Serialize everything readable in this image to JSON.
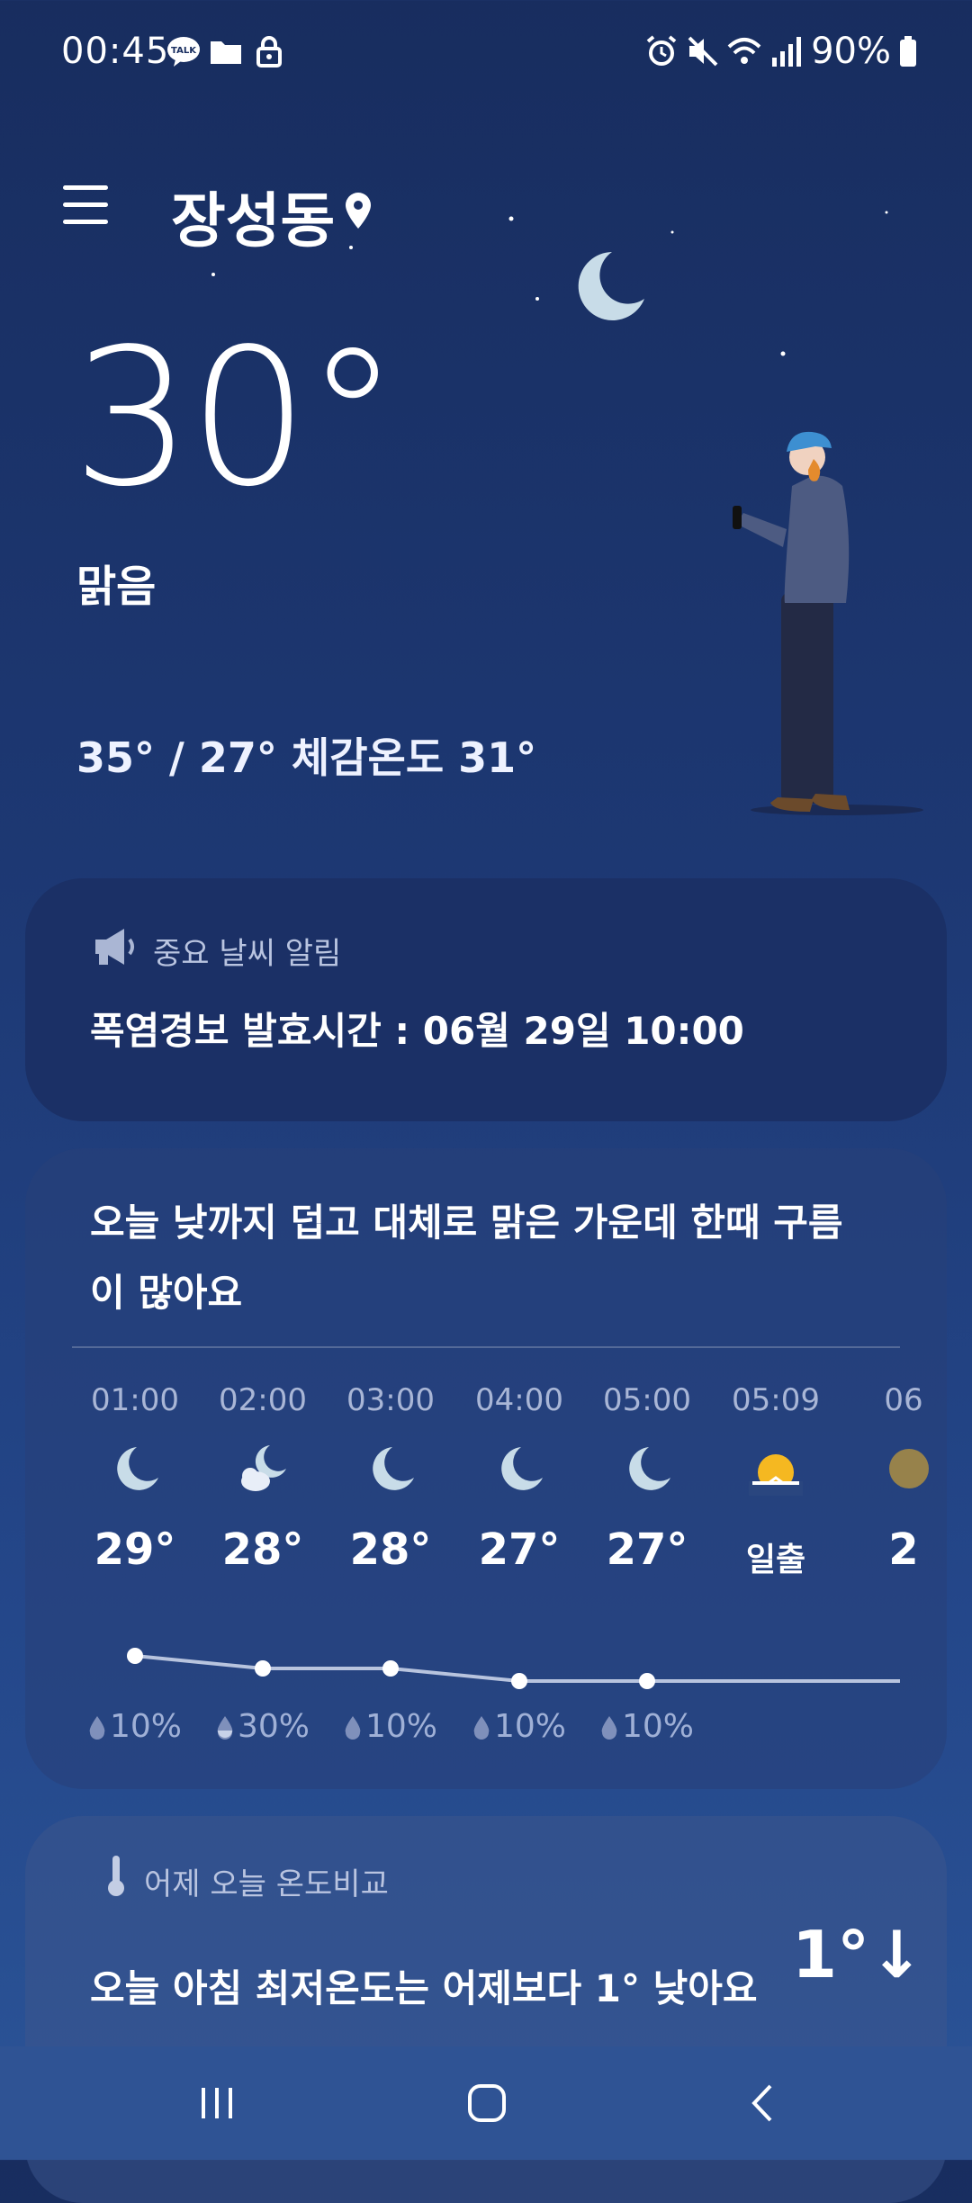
{
  "status_bar": {
    "time": "00:45",
    "talk_badge": "TALK",
    "battery": "90%"
  },
  "header": {
    "location": "장성동"
  },
  "current": {
    "temperature": "30°",
    "condition": "맑음",
    "min_max_feels": "35° / 27° 체감온도 31°"
  },
  "alert": {
    "title": "중요 날씨 알림",
    "text": "폭염경보  발효시간 : 06월 29일 10:00"
  },
  "forecast": {
    "summary": "오늘 낮까지 덥고 대체로 맑은 가운데 한때 구름이 많아요",
    "hours": [
      {
        "time": "01:00",
        "icon": "moon-icon",
        "temp": "29°",
        "pop": "10%"
      },
      {
        "time": "02:00",
        "icon": "moon-cloud-icon",
        "temp": "28°",
        "pop": "30%"
      },
      {
        "time": "03:00",
        "icon": "moon-icon",
        "temp": "28°",
        "pop": "10%"
      },
      {
        "time": "04:00",
        "icon": "moon-icon",
        "temp": "27°",
        "pop": "10%"
      },
      {
        "time": "05:00",
        "icon": "moon-icon",
        "temp": "27°",
        "pop": "10%"
      },
      {
        "time": "05:09",
        "icon": "sunrise-icon",
        "label": "일출"
      },
      {
        "time": "06",
        "icon": "sun-icon",
        "temp": "2"
      }
    ]
  },
  "compare": {
    "title": "어제 오늘 온도비교",
    "text": "오늘 아침 최저온도는 어제보다 1° 낮아요",
    "value": "1°↓"
  },
  "colors": {
    "background_top": "#182d5f",
    "background_bottom": "#2b5497",
    "moon": "#c8dce8",
    "sun": "#f5b821"
  }
}
